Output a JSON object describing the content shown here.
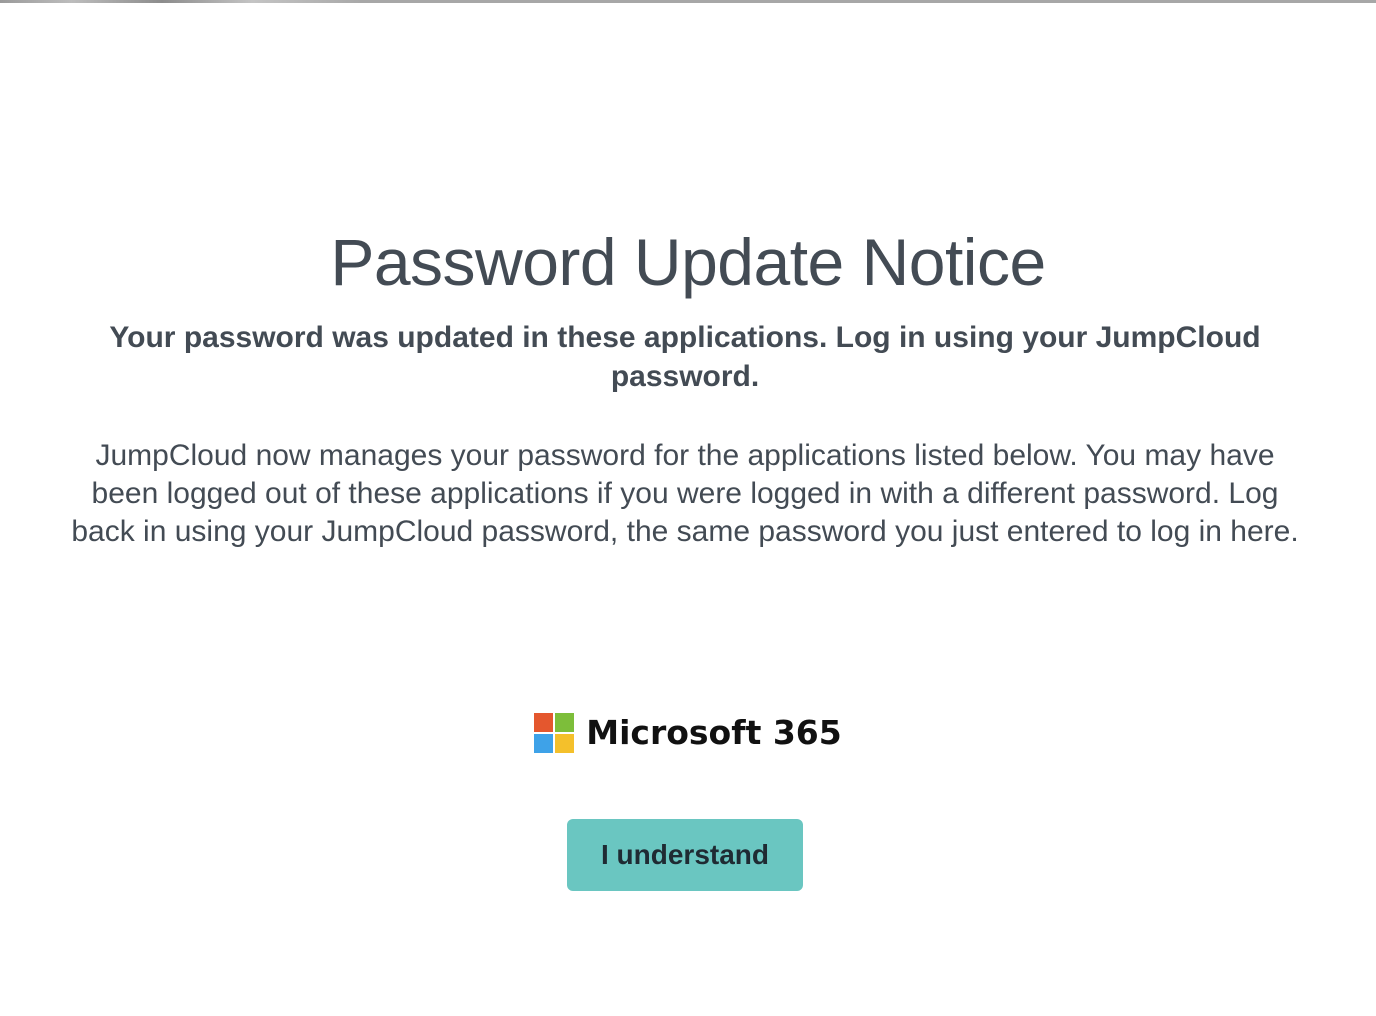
{
  "page": {
    "title": "Password Update Notice",
    "subtitle": "Your password was updated in these applications. Log in using your JumpCloud password.",
    "description": "JumpCloud now manages your password for the applications listed below. You may have been logged out of these applications if you were logged in with a different password. Log back in using your JumpCloud password, the same password you just entered to log in here."
  },
  "applications": [
    {
      "name": "Microsoft 365",
      "icon": "microsoft-logo-icon",
      "logo_colors": [
        "#e4572e",
        "#7dbe3a",
        "#3ea2e8",
        "#f4c02b"
      ]
    }
  ],
  "actions": {
    "confirm_label": "I understand"
  },
  "colors": {
    "accent": "#6ac6c1",
    "text": "#434b54"
  }
}
